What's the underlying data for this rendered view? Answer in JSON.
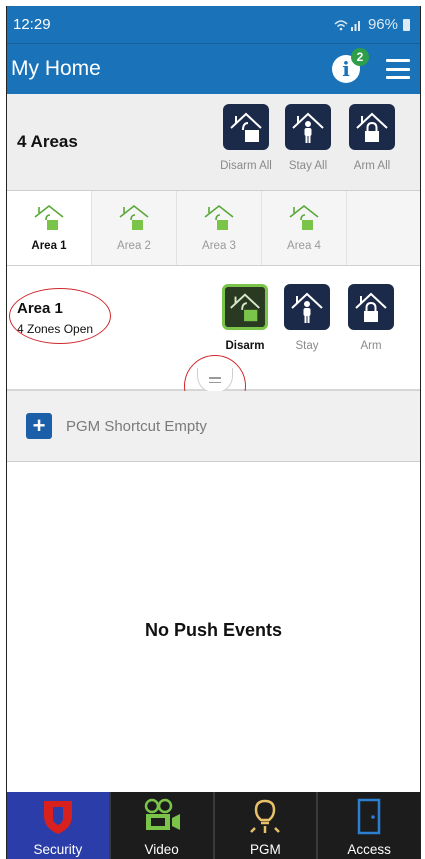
{
  "status": {
    "time": "12:29",
    "battery": "96%"
  },
  "appbar": {
    "title": "My Home",
    "info_badge": "2"
  },
  "summary": {
    "label": "4 Areas",
    "actions": [
      {
        "label": "Disarm All",
        "icon": "house-unlocked-icon"
      },
      {
        "label": "Stay All",
        "icon": "house-person-icon"
      },
      {
        "label": "Arm All",
        "icon": "house-locked-icon"
      }
    ]
  },
  "tabs": [
    {
      "label": "Area 1",
      "selected": true
    },
    {
      "label": "Area 2",
      "selected": false
    },
    {
      "label": "Area 3",
      "selected": false
    },
    {
      "label": "Area 4",
      "selected": false
    }
  ],
  "area": {
    "name": "Area 1",
    "zones": "4 Zones Open",
    "actions": [
      {
        "label": "Disarm",
        "active": true
      },
      {
        "label": "Stay",
        "active": false
      },
      {
        "label": "Arm",
        "active": false
      }
    ]
  },
  "pgm": {
    "label": "PGM Shortcut Empty"
  },
  "events": {
    "message": "No Push Events"
  },
  "nav": [
    {
      "label": "Security",
      "icon": "shield-icon",
      "active": true
    },
    {
      "label": "Video",
      "icon": "video-camera-icon",
      "active": false
    },
    {
      "label": "PGM",
      "icon": "light-bulb-icon",
      "active": false
    },
    {
      "label": "Access",
      "icon": "door-icon",
      "active": false
    }
  ],
  "colors": {
    "primary": "#1a73b8",
    "button_dark": "#1c2a4a",
    "accent_green": "#7bc44a",
    "annotation_red": "#d0282d",
    "nav_active": "#2b3da8"
  }
}
